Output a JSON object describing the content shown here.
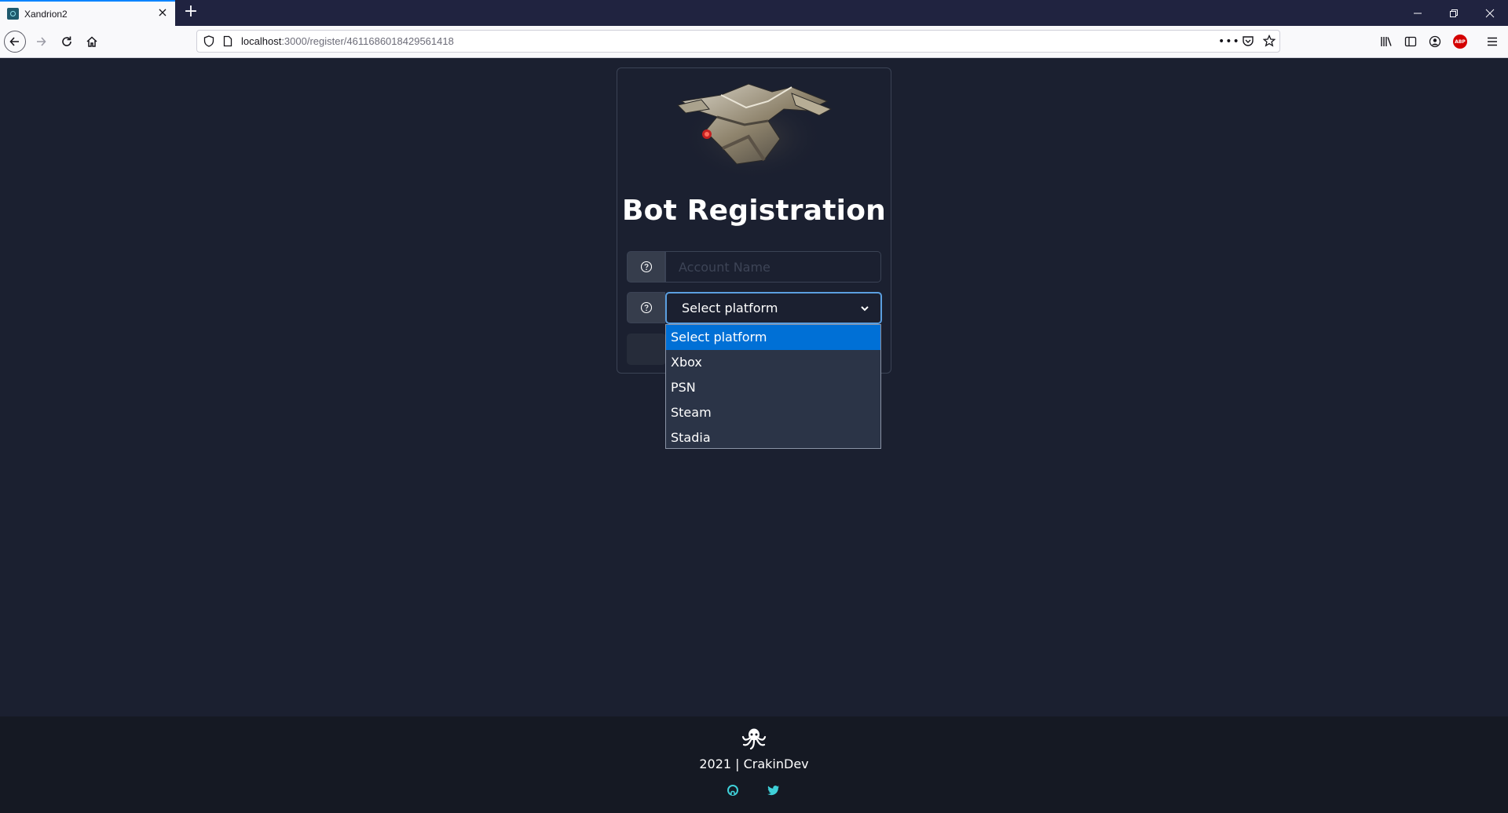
{
  "browser": {
    "tab_title": "Xandrion2",
    "url_host": "localhost",
    "url_path": ":3000/register/461168601842956141​8",
    "new_tab_symbol": "+",
    "close_symbol": "×",
    "abp_label": "ABP"
  },
  "page": {
    "title": "Bot Registration",
    "account_placeholder": "Account Name",
    "platform_selected": "Select platform",
    "platform_options": [
      "Select platform",
      "Xbox",
      "PSN",
      "Steam",
      "Stadia"
    ]
  },
  "footer": {
    "text": "2021 | CrakinDev",
    "links": [
      "github-icon",
      "twitter-icon"
    ],
    "accent": "#3fd0d8"
  }
}
